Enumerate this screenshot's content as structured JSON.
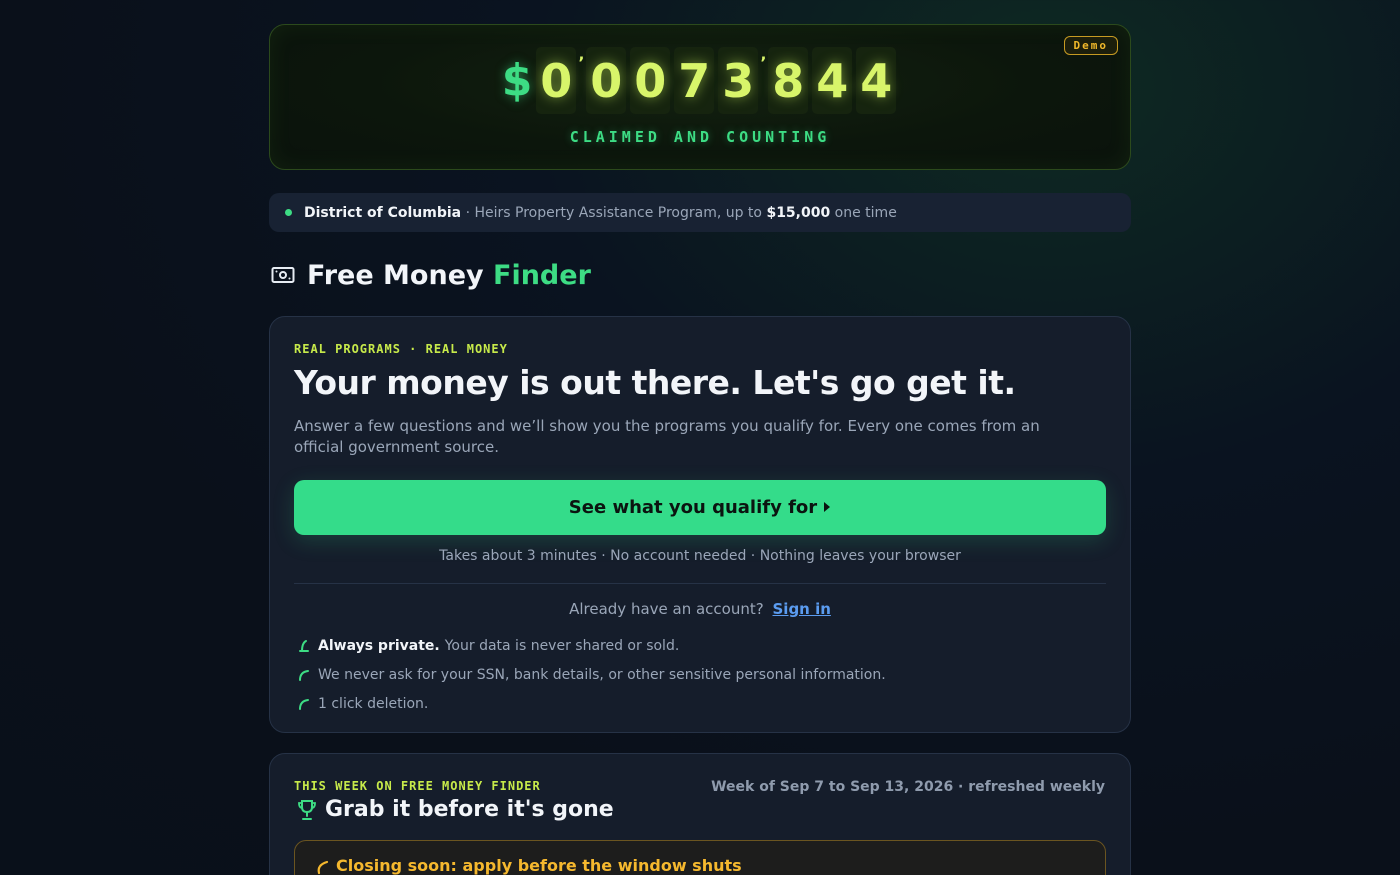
{
  "counter": {
    "currency_symbol": "$",
    "digits": [
      "0",
      "0",
      "0",
      "7",
      "3",
      "8",
      "4",
      "4"
    ],
    "separator": "’",
    "caption": "CLAIMED AND COUNTING",
    "badge": "Demo"
  },
  "ticker": {
    "location": "District of Columbia",
    "sep": "·",
    "program": "Heirs Property Assistance Program, up to",
    "amount": "$15,000",
    "suffix": "one time"
  },
  "brand": {
    "title_part1": "Free Money",
    "title_part2": "Finder",
    "icon": "banknote-icon"
  },
  "hero": {
    "eyebrow": "REAL PROGRAMS · REAL MONEY",
    "headline": "Your money is out there. Let's go get it.",
    "lead": "Answer a few questions and we’ll show you the programs you qualify for. Every one comes from an official government source.",
    "cta_label": "See what you qualify for",
    "cta_note": "Takes about 3 minutes · No account needed · Nothing leaves your browser",
    "signin_prompt": "Already have an account?",
    "signin_link": "Sign in",
    "privacy": [
      {
        "strong": "Always private.",
        "text": "Your data is never shared or sold."
      },
      {
        "strong": "",
        "text": "We never ask for your SSN, bank details, or other sensitive personal information."
      },
      {
        "strong": "",
        "text": "1 click deletion."
      }
    ]
  },
  "weekly": {
    "eyebrow": "THIS WEEK ON FREE MONEY FINDER",
    "title": "Grab it before it's gone",
    "week_range": "Week of Sep 7 to Sep 13, 2026 · refreshed weekly",
    "closing_label": "Closing soon: apply before the window shuts"
  },
  "colors": {
    "accent_green": "#34dc8a",
    "digit_yellow": "#d8f56a",
    "link_blue": "#5b9cf0",
    "warning_amber": "#f5b82e"
  }
}
